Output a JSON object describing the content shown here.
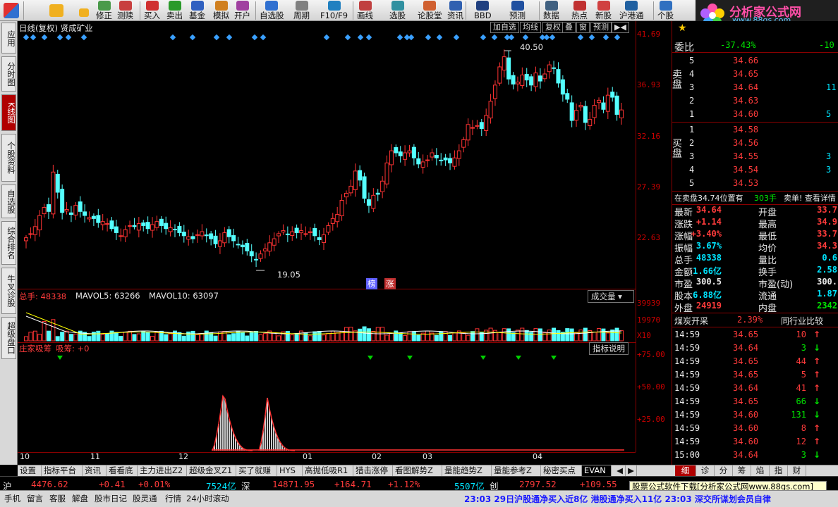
{
  "toolbar": {
    "buttons": [
      {
        "label": "修正",
        "color": "#4a9a4a"
      },
      {
        "label": "测赎",
        "color": "#c84040"
      },
      {
        "label": "买入",
        "color": "#d03030"
      },
      {
        "label": "卖出",
        "color": "#2a9a2a"
      },
      {
        "label": "基金",
        "color": "#3060c0"
      },
      {
        "label": "模拟",
        "color": "#d08020"
      },
      {
        "label": "开户",
        "color": "#a040a0"
      },
      {
        "label": "自选股",
        "color": "#3070d0"
      },
      {
        "label": "周期",
        "color": "#808080"
      },
      {
        "label": "F10/F9",
        "color": "#2080c0"
      },
      {
        "label": "画线",
        "color": "#c04040"
      },
      {
        "label": "选股",
        "color": "#3090a0"
      },
      {
        "label": "论股堂",
        "color": "#d06030"
      },
      {
        "label": "资讯",
        "color": "#3060b0"
      },
      {
        "label": "BBD",
        "color": "#204080"
      },
      {
        "label": "预测",
        "color": "#2050a0"
      },
      {
        "label": "数据",
        "color": "#406080"
      },
      {
        "label": "热点",
        "color": "#c03030"
      },
      {
        "label": "新股",
        "color": "#d04040"
      },
      {
        "label": "沪港通",
        "color": "#2060a0"
      },
      {
        "label": "个股",
        "color": "#3070c0"
      }
    ],
    "logo_cn": "分析家公式网",
    "logo_url": "www.88gs.com"
  },
  "left_tabs": [
    "应用",
    "分时图",
    "K线图",
    "个股资料",
    "自选股",
    "综合排名",
    "牛叉诊股",
    "超级盘口"
  ],
  "chart": {
    "title": "日线(复权)  贤成矿业",
    "buttons": [
      "加自选",
      "均线",
      "复权",
      "叠",
      "窗",
      "预测"
    ],
    "price_labels": [
      "41.69",
      "36.93",
      "32.16",
      "27.39",
      "22.63"
    ],
    "high_label": "40.50",
    "low_label": "19.05",
    "tags": [
      "榜",
      "涨"
    ],
    "volume_header": {
      "total": "总手: 48338",
      "ma5": "MAVOL5: 63266",
      "ma10": "MAVOL10: 63097"
    },
    "volume_button": "成交量",
    "volume_labels": [
      "39939",
      "19970",
      "X10"
    ],
    "indicator_header": {
      "name": "庄家吸筹",
      "sub": "吸筹: +0"
    },
    "indicator_button": "指标说明",
    "indicator_labels": [
      "+75.00",
      "+50.00",
      "+25.00"
    ],
    "x_labels": [
      "10",
      "11",
      "12",
      "01",
      "02",
      "03",
      "04"
    ]
  },
  "chart_data": {
    "type": "candlestick",
    "price_ylim": [
      19.05,
      41.69
    ],
    "high": 40.5,
    "low": 19.05
  },
  "orderbook": {
    "weibi_label": "委比",
    "weibi_value": "-37.43%",
    "weicha_value": "-10",
    "sell_label": "卖盘",
    "buy_label": "买盘",
    "sells": [
      {
        "n": "5",
        "price": "34.66",
        "vol": ""
      },
      {
        "n": "4",
        "price": "34.65",
        "vol": ""
      },
      {
        "n": "3",
        "price": "34.64",
        "vol": "11"
      },
      {
        "n": "2",
        "price": "34.63",
        "vol": ""
      },
      {
        "n": "1",
        "price": "34.60",
        "vol": "5"
      }
    ],
    "buys": [
      {
        "n": "1",
        "price": "34.58",
        "vol": ""
      },
      {
        "n": "2",
        "price": "34.56",
        "vol": ""
      },
      {
        "n": "3",
        "price": "34.55",
        "vol": "3"
      },
      {
        "n": "4",
        "price": "34.54",
        "vol": "3"
      },
      {
        "n": "5",
        "price": "34.53",
        "vol": ""
      }
    ],
    "info_line": "在卖盘34.74位置有",
    "info_vol": "303手",
    "info_link": "卖单! 查看详情"
  },
  "stats": [
    {
      "l": "最新",
      "v": "34.64",
      "vc": "red",
      "l2": "开盘",
      "v2": "33.7",
      "v2c": "red"
    },
    {
      "l": "涨跌",
      "v": "+1.14",
      "vc": "red",
      "l2": "最高",
      "v2": "34.9",
      "v2c": "red"
    },
    {
      "l": "涨幅",
      "v": "+3.40%",
      "vc": "red",
      "l2": "最低",
      "v2": "33.7",
      "v2c": "red"
    },
    {
      "l": "振幅",
      "v": "3.67%",
      "vc": "cyan",
      "l2": "均价",
      "v2": "34.3",
      "v2c": "red"
    },
    {
      "l": "总手",
      "v": "48338",
      "vc": "cyan",
      "l2": "量比",
      "v2": "0.6",
      "v2c": "cyan"
    },
    {
      "l": "金额",
      "v": "1.66亿",
      "vc": "cyan",
      "l2": "换手",
      "v2": "2.58",
      "v2c": "cyan"
    },
    {
      "l": "市盈",
      "v": "300.5",
      "vc": "white",
      "l2": "市盈(动)",
      "v2": "300.",
      "v2c": "white"
    },
    {
      "l": "股本",
      "v": "6.88亿",
      "vc": "cyan",
      "l2": "流通",
      "v2": "1.87",
      "v2c": "cyan"
    },
    {
      "l": "外盘",
      "v": "24919",
      "vc": "red",
      "l2": "内盘",
      "v2": "2342",
      "v2c": "green"
    }
  ],
  "sector": {
    "name": "煤炭开采",
    "change": "2.39%",
    "compare": "同行业比较"
  },
  "ticks": [
    {
      "t": "14:59",
      "p": "34.65",
      "v": "10",
      "d": "up"
    },
    {
      "t": "14:59",
      "p": "34.64",
      "v": "3",
      "d": "down"
    },
    {
      "t": "14:59",
      "p": "34.65",
      "v": "44",
      "d": "up"
    },
    {
      "t": "14:59",
      "p": "34.65",
      "v": "5",
      "d": "up"
    },
    {
      "t": "14:59",
      "p": "34.64",
      "v": "41",
      "d": "up"
    },
    {
      "t": "14:59",
      "p": "34.65",
      "v": "66",
      "d": "down"
    },
    {
      "t": "14:59",
      "p": "34.60",
      "v": "131",
      "d": "down"
    },
    {
      "t": "14:59",
      "p": "34.60",
      "v": "8",
      "d": "up"
    },
    {
      "t": "14:59",
      "p": "34.60",
      "v": "12",
      "d": "up"
    },
    {
      "t": "15:00",
      "p": "34.64",
      "v": "3",
      "d": "down"
    }
  ],
  "right_tabs": [
    "细",
    "诊",
    "分",
    "筹",
    "焰",
    "指",
    "财"
  ],
  "bottom_tabs": [
    "设置",
    "指标平台",
    "资讯",
    "看看底",
    "主力进出Z2",
    "超级金叉Z1",
    "买了就赚",
    "HYS",
    "高抛低吸R1",
    "猎击涨停",
    "看图解势Z",
    "量能趋势Z",
    "量能参考Z",
    "秘密买点",
    "EVAN"
  ],
  "indexbar": {
    "sh_label": "沪",
    "sh_val": "4476.62",
    "sh_chg": "+0.41",
    "sh_pct": "+0.01%",
    "sh_amt": "7524亿",
    "sz_label": "深",
    "sz_val": "14871.95",
    "sz_chg": "+164.71",
    "sz_pct": "+1.12%",
    "sz_amt": "5507亿",
    "cy_label": "创",
    "cy_val": "2797.52",
    "cy_chg": "+109.55"
  },
  "ad_text": "股票公式软件下载[分析家公式网www.88gs.com]",
  "statusbar": {
    "items": [
      "手机",
      "留言",
      "客服",
      "解盘",
      "股市日记",
      "股灵通",
      "行情",
      "24小时滚动"
    ],
    "ticker": "23:03 29日沪股通净买入近8亿 港股通净买入11亿  23:03 深交所谋划会员自律"
  }
}
